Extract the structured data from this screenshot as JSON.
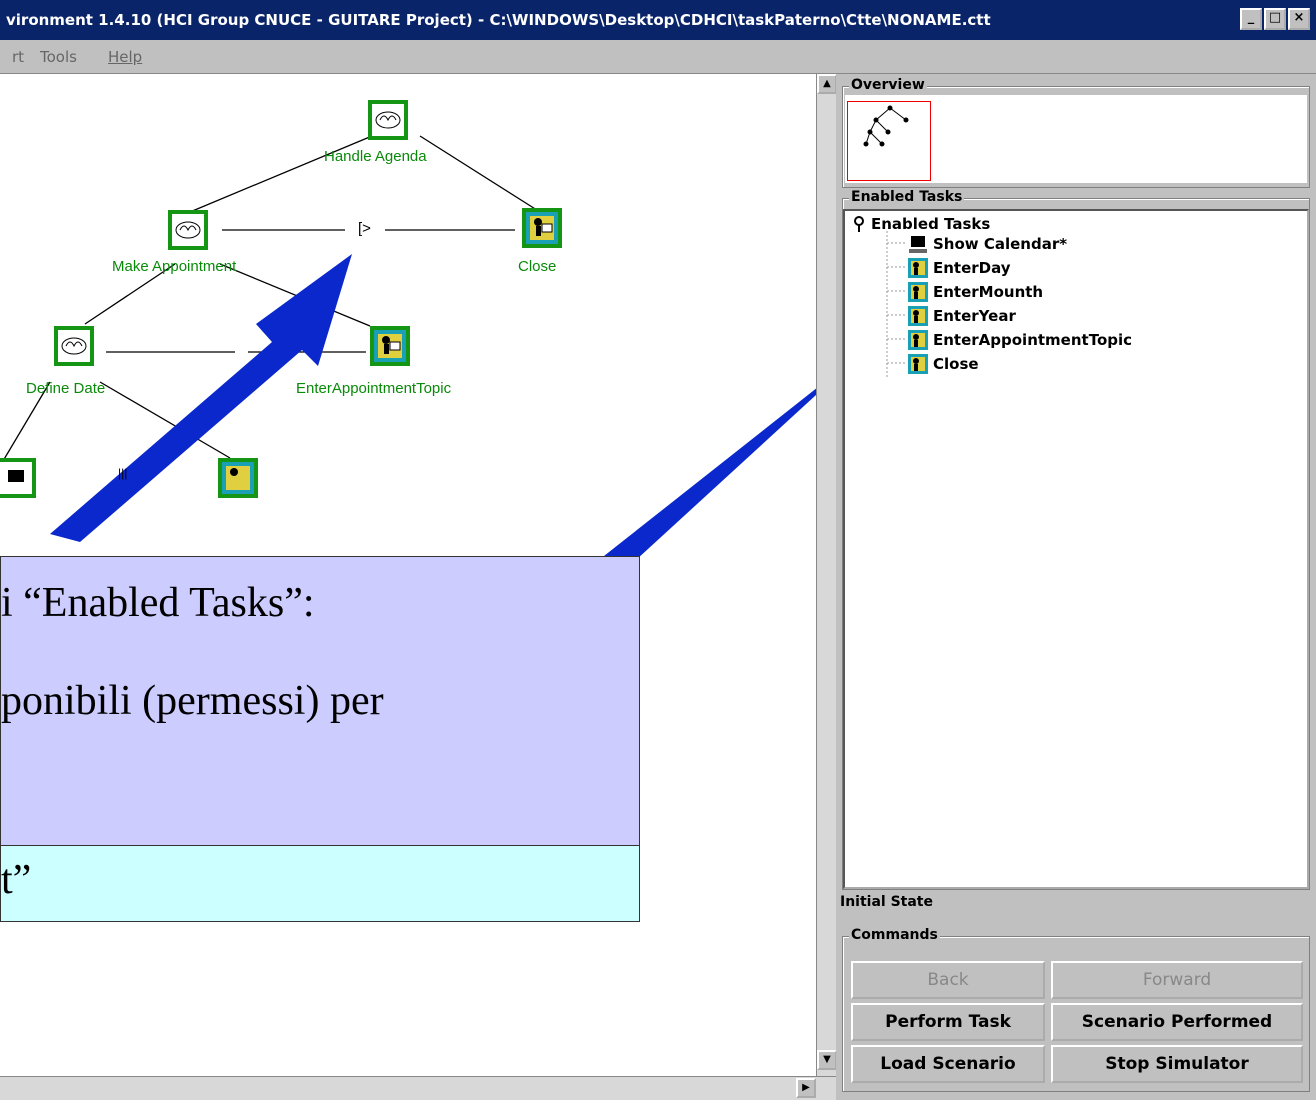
{
  "window": {
    "title": "vironment 1.4.10 (HCI Group CNUCE - GUITARE Project) - C:\\WINDOWS\\Desktop\\CDHCI\\taskPaterno\\Ctte\\NONAME.ctt",
    "minimize": "_",
    "maximize": "□",
    "close": "×"
  },
  "menu": {
    "partial": "rt",
    "tools": "Tools",
    "help": "Help"
  },
  "diagram": {
    "nodes": {
      "handle_agenda": "Handle Agenda",
      "make_appointment": "Make Appointment",
      "close": "Close",
      "define_date": "Define Date",
      "enter_topic": "EnterAppointmentTopic"
    },
    "operators": {
      "disabling": "[>",
      "partial": "|||"
    }
  },
  "callout": {
    "line1": "i “Enabled Tasks”:",
    "line2": "ponibili (permessi) per",
    "line3": "t”"
  },
  "overview": {
    "label": "Overview"
  },
  "enabled_tasks": {
    "group_label": "Enabled Tasks",
    "root_label": "Enabled Tasks",
    "items": [
      {
        "label": "Show Calendar*",
        "icon": "computer-icon"
      },
      {
        "label": "EnterDay",
        "icon": "user-task-icon"
      },
      {
        "label": "EnterMounth",
        "icon": "user-task-icon"
      },
      {
        "label": "EnterYear",
        "icon": "user-task-icon"
      },
      {
        "label": "EnterAppointmentTopic",
        "icon": "user-task-icon"
      },
      {
        "label": "Close",
        "icon": "user-task-icon"
      }
    ]
  },
  "status": {
    "state": "Initial State"
  },
  "commands": {
    "group_label": "Commands",
    "back": "Back",
    "forward": "Forward",
    "perform_task": "Perform Task",
    "scenario_performed": "Scenario Performed",
    "load_scenario": "Load Scenario",
    "stop_simulator": "Stop Simulator"
  },
  "colors": {
    "titlebar": "#0a246a",
    "node_border": "#149614",
    "label_green": "#0a8a0a",
    "arrow": "#0a28cc",
    "callout_bg": "#ccccff",
    "callout2_bg": "#ccffff"
  }
}
